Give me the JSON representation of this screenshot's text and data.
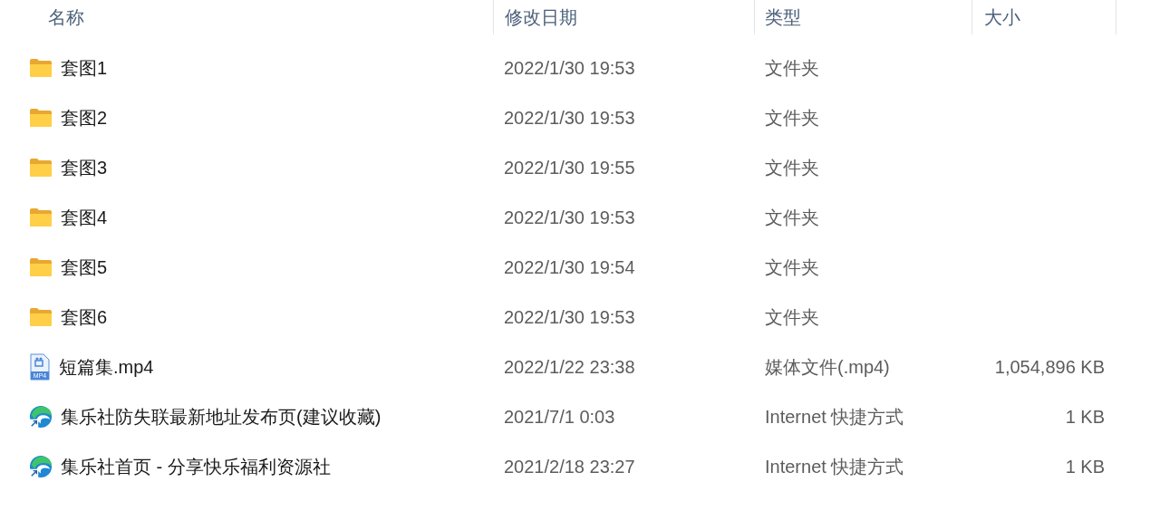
{
  "columns": [
    "名称",
    "修改日期",
    "类型",
    "大小"
  ],
  "rows": [
    {
      "kind": "folder",
      "name": "套图1",
      "modified": "2022/1/30 19:53",
      "type": "文件夹"
    },
    {
      "kind": "folder",
      "name": "套图2",
      "modified": "2022/1/30 19:53",
      "type": "文件夹"
    },
    {
      "kind": "folder",
      "name": "套图3",
      "modified": "2022/1/30 19:55",
      "type": "文件夹"
    },
    {
      "kind": "folder",
      "name": "套图4",
      "modified": "2022/1/30 19:53",
      "type": "文件夹"
    },
    {
      "kind": "folder",
      "name": "套图5",
      "modified": "2022/1/30 19:54",
      "type": "文件夹"
    },
    {
      "kind": "folder",
      "name": "套图6",
      "modified": "2022/1/30 19:53",
      "type": "文件夹"
    },
    {
      "kind": "video",
      "name": "短篇集.mp4",
      "icon_label": "MP4",
      "modified": "2022/1/22 23:38",
      "type": "媒体文件(.mp4)",
      "size": "1,054,896 KB"
    },
    {
      "kind": "shortcut",
      "name": "集乐社防失联最新地址发布页(建议收藏)",
      "modified": "2021/7/1 0:03",
      "type": "Internet 快捷方式",
      "size": "1 KB"
    },
    {
      "kind": "shortcut",
      "name": "集乐社首页 - 分享快乐福利资源社",
      "modified": "2021/2/18 23:27",
      "type": "Internet 快捷方式",
      "size": "1 KB"
    }
  ]
}
